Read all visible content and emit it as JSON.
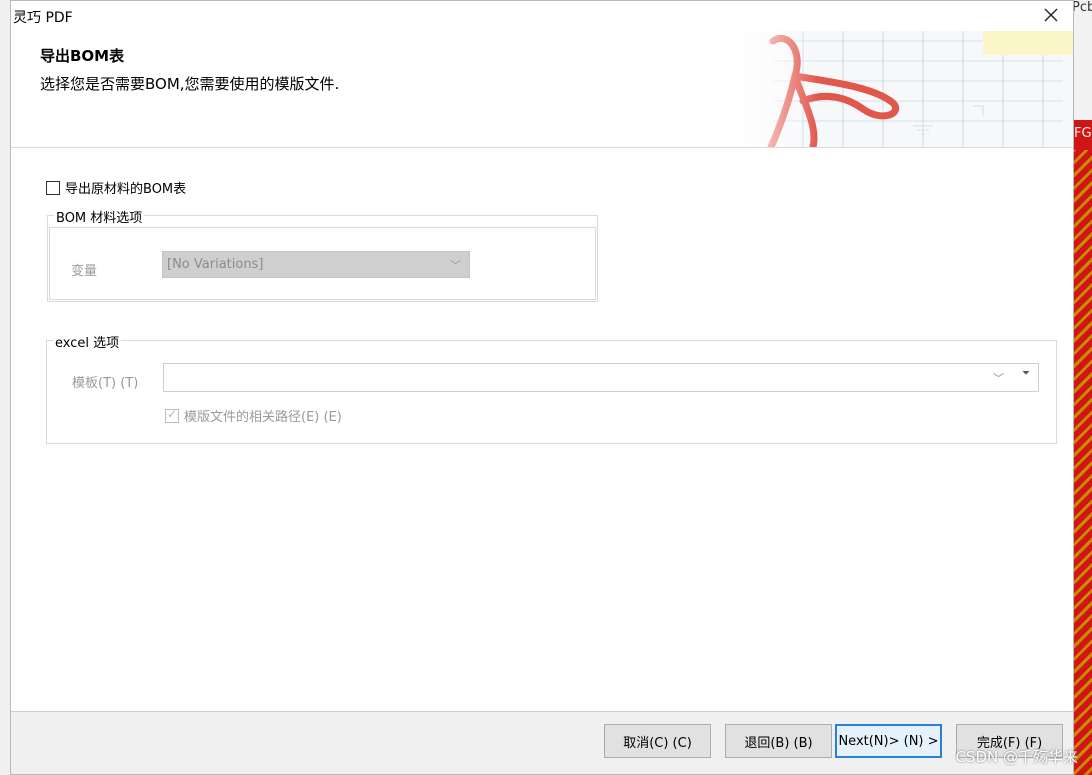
{
  "window": {
    "title": "灵巧 PDF"
  },
  "header": {
    "title": "导出BOM表",
    "subtitle": "选择您是否需要BOM,您需要使用的模版文件."
  },
  "export_bom": {
    "label": "导出原材料的BOM表",
    "checked": false
  },
  "bom_group": {
    "legend": "BOM 材料选项",
    "variant_label": "变量",
    "variant_value": "[No Variations]"
  },
  "excel_group": {
    "legend": "excel 选项",
    "template_label": "模板(T) (T)",
    "template_value": "",
    "relative_path_label": "模版文件的相关路径(E) (E)",
    "relative_path_checked": true
  },
  "footer": {
    "cancel": "取消(C) (C)",
    "back": "退回(B) (B)",
    "next": "Next(N)> (N) >",
    "finish": "完成(F) (F)"
  },
  "background": {
    "right_text_1": "Pcb",
    "right_text_2": "FG",
    "watermark": "CSDN @千殇华来"
  },
  "colors": {
    "accent": "#2b7fd4",
    "logo": "#e2574c"
  }
}
